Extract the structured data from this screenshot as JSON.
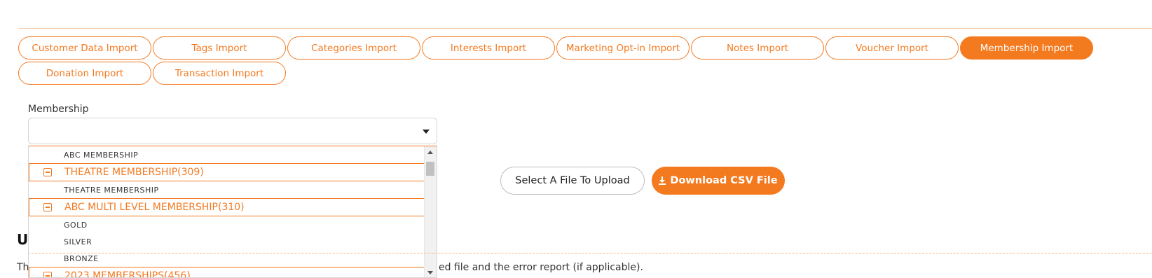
{
  "tabs": [
    {
      "label": "Customer Data Import",
      "active": false
    },
    {
      "label": "Tags Import",
      "active": false
    },
    {
      "label": "Categories Import",
      "active": false
    },
    {
      "label": "Interests Import",
      "active": false
    },
    {
      "label": "Marketing Opt-in Import",
      "active": false
    },
    {
      "label": "Notes Import",
      "active": false
    },
    {
      "label": "Voucher Import",
      "active": false
    },
    {
      "label": "Membership Import",
      "active": true
    },
    {
      "label": "Donation Import",
      "active": false
    },
    {
      "label": "Transaction Import",
      "active": false
    }
  ],
  "membership": {
    "label": "Membership",
    "selected_value": "",
    "options": [
      {
        "kind": "item",
        "label": "ABC MEMBERSHIP"
      },
      {
        "kind": "group",
        "label": "THEATRE MEMBERSHIP(309)"
      },
      {
        "kind": "item",
        "label": "THEATRE MEMBERSHIP"
      },
      {
        "kind": "group",
        "label": "ABC MULTI LEVEL MEMBERSHIP(310)"
      },
      {
        "kind": "item",
        "label": "GOLD"
      },
      {
        "kind": "item",
        "label": "SILVER"
      },
      {
        "kind": "item",
        "label": "BRONZE"
      },
      {
        "kind": "group",
        "label": "2023 MEMBERSHIPS(456)"
      }
    ]
  },
  "actions": {
    "upload_label": "Select A File To Upload",
    "download_label": "Download CSV File"
  },
  "section": {
    "heading_partial": "U",
    "text_left": "Th",
    "text_right": "ed file and the error report (if applicable)."
  },
  "colors": {
    "accent": "#f47a20"
  }
}
